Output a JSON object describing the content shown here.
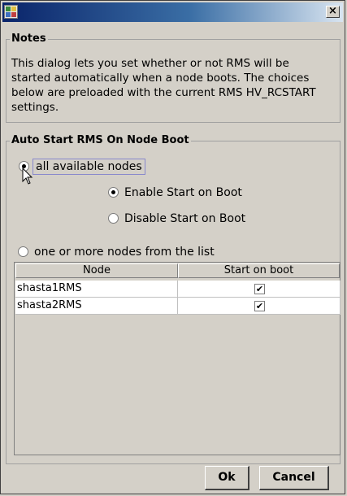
{
  "window": {
    "close_glyph": "×",
    "icon": "app-icon"
  },
  "notes": {
    "title": "Notes",
    "text": "This dialog lets you set whether or not RMS will be started automatically when a node boots. The choices below are preloaded with the current RMS HV_RCSTART settings."
  },
  "auto_start": {
    "title": "Auto Start RMS On Node Boot",
    "all_nodes_label": "all available nodes",
    "all_nodes_selected": true,
    "enable_label": "Enable Start on Boot",
    "enable_selected": true,
    "disable_label": "Disable Start on Boot",
    "disable_selected": false,
    "list_label": "one or more nodes from the list",
    "list_selected": false
  },
  "table": {
    "columns": [
      "Node",
      "Start on boot"
    ],
    "rows": [
      {
        "node": "shasta1RMS",
        "checked": true,
        "mark": "✔"
      },
      {
        "node": "shasta2RMS",
        "checked": true,
        "mark": "✔"
      }
    ]
  },
  "buttons": {
    "ok": "Ok",
    "cancel": "Cancel"
  }
}
